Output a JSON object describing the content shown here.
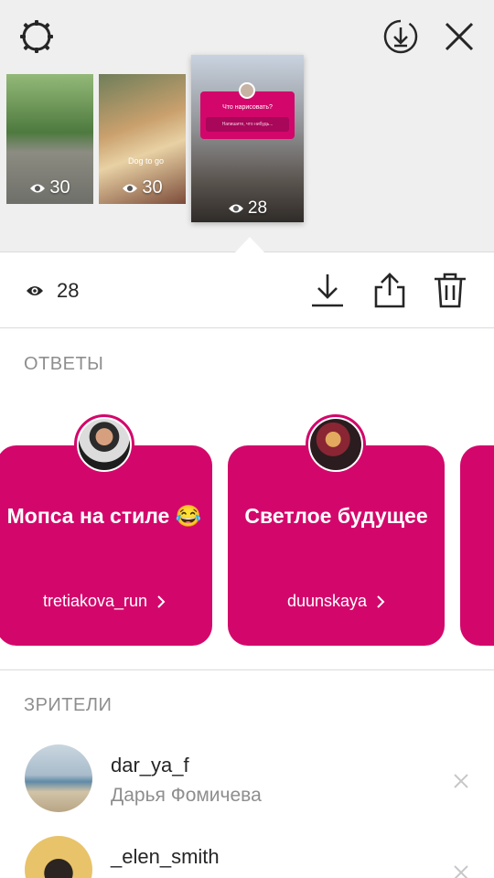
{
  "top": {
    "thumbnails": [
      {
        "views": "30"
      },
      {
        "views": "30",
        "sticker_text": "Dog to go"
      },
      {
        "views": "28",
        "question_title": "Что нарисовать?",
        "question_placeholder": "Напишите, что нибудь..."
      }
    ]
  },
  "stats": {
    "views": "28"
  },
  "sections": {
    "replies": "ОТВЕТЫ",
    "viewers": "ЗРИТЕЛИ"
  },
  "replies": [
    {
      "text": "Мопса на стиле 😂",
      "user": "tretiakova_run"
    },
    {
      "text": "Светлое будущее",
      "user": "duunskaya"
    }
  ],
  "viewers": [
    {
      "username": "dar_ya_f",
      "full_name": "Дарья Фомичева"
    },
    {
      "username": "_elen_smith",
      "full_name": ""
    }
  ],
  "colors": {
    "accent": "#d3076b",
    "secondary_text": "#8e8e8e",
    "top_bg": "#efefef"
  },
  "icons": [
    "settings-icon",
    "save-circle-icon",
    "close-icon",
    "eye-icon",
    "download-icon",
    "share-icon",
    "trash-icon",
    "chevron-right-icon",
    "remove-icon"
  ]
}
